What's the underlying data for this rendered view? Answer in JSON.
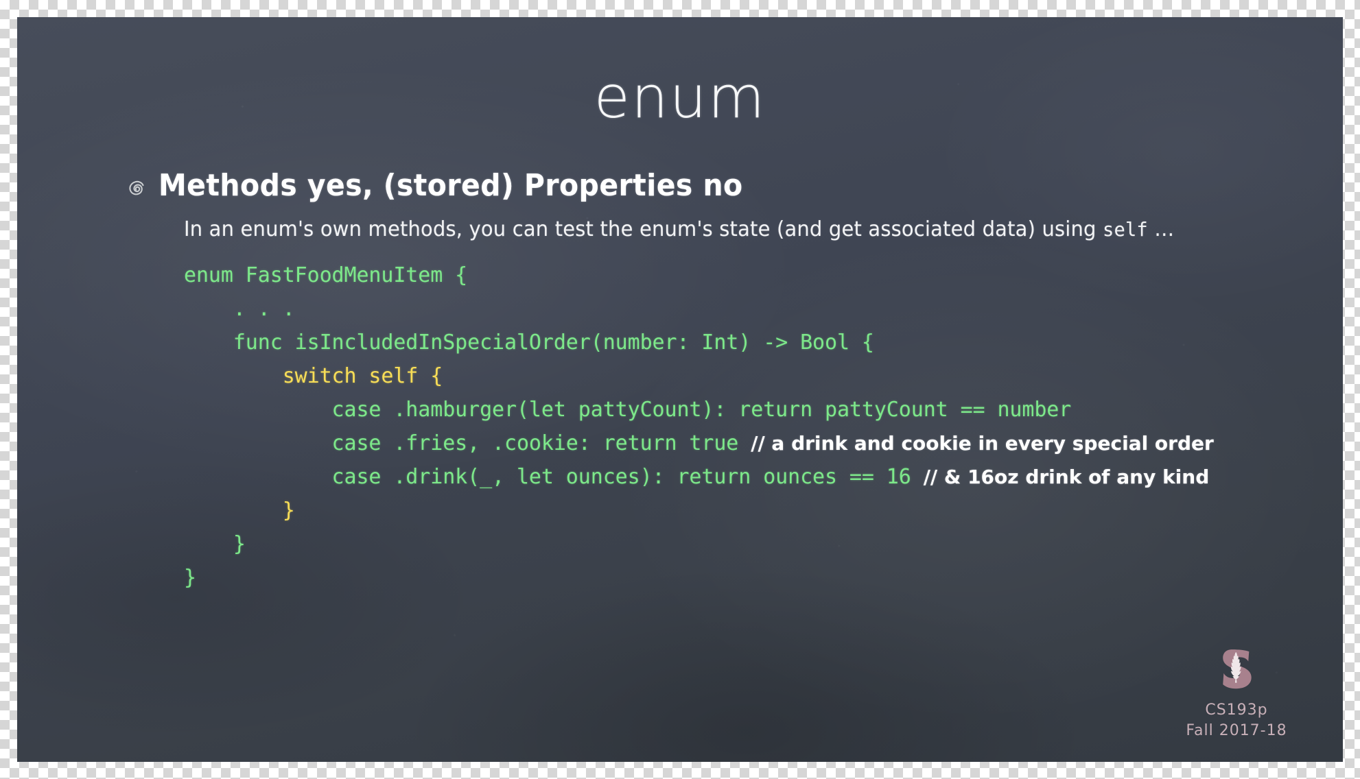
{
  "slide": {
    "title": "enum",
    "background_color": "#414754",
    "bullet": {
      "icon": "chalk-swirl-bullet-icon",
      "heading": "Methods yes, (stored) Properties no"
    },
    "subline": {
      "prefix": "In an enum's own methods, you can test the enum's state (and get associated data) using ",
      "mono": "self",
      "suffix": " …"
    },
    "code": {
      "color_default": "#7de88a",
      "color_keyword": "#f7dd57",
      "color_comment": "#ffffff",
      "lines": [
        {
          "indent": 0,
          "segments": [
            {
              "style": "default",
              "text": "enum FastFoodMenuItem {"
            }
          ]
        },
        {
          "indent": 0,
          "segments": [
            {
              "style": "default",
              "text": "    . . ."
            }
          ]
        },
        {
          "indent": 0,
          "segments": [
            {
              "style": "default",
              "text": "    func isIncludedInSpecialOrder(number: Int) -> Bool {"
            }
          ]
        },
        {
          "indent": 0,
          "segments": [
            {
              "style": "keyword",
              "text": "        switch self {"
            }
          ]
        },
        {
          "indent": 0,
          "segments": [
            {
              "style": "default",
              "text": "            case .hamburger(let pattyCount): return pattyCount == number"
            }
          ]
        },
        {
          "indent": 0,
          "segments": [
            {
              "style": "default",
              "text": "            case .fries, .cookie: return true "
            },
            {
              "style": "comment",
              "text": "// a drink and cookie in every special order"
            }
          ]
        },
        {
          "indent": 0,
          "segments": [
            {
              "style": "default",
              "text": "            case .drink(_, let ounces): return ounces == 16 "
            },
            {
              "style": "comment",
              "text": "// & 16oz drink of any kind"
            }
          ]
        },
        {
          "indent": 0,
          "segments": [
            {
              "style": "keyword",
              "text": "        }"
            }
          ]
        },
        {
          "indent": 0,
          "segments": [
            {
              "style": "default",
              "text": "    }"
            }
          ]
        },
        {
          "indent": 0,
          "segments": [
            {
              "style": "default",
              "text": "}"
            }
          ]
        }
      ]
    },
    "footer": {
      "logo": "stanford-tree-s-logo",
      "logo_color": "#a8818d",
      "course": "CS193p",
      "term": "Fall 2017-18"
    }
  }
}
